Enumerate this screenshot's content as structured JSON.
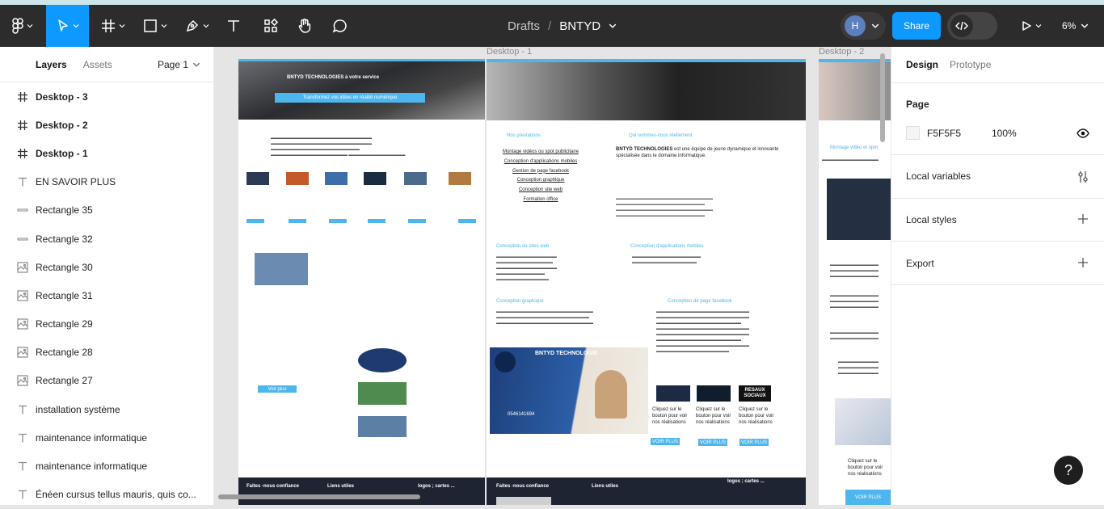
{
  "toolbar": {
    "breadcrumb_project": "Drafts",
    "breadcrumb_separator": "/",
    "file_name": "BNTYD",
    "avatar_initial": "H",
    "share_label": "Share",
    "zoom_label": "6%",
    "accent_color": "#0d99ff"
  },
  "left_panel": {
    "tab_layers": "Layers",
    "tab_assets": "Assets",
    "page_selector": "Page 1",
    "layers": [
      {
        "label": "Desktop - 3",
        "icon": "frame-icon",
        "type": "frame"
      },
      {
        "label": "Desktop - 2",
        "icon": "frame-icon",
        "type": "frame"
      },
      {
        "label": "Desktop - 1",
        "icon": "frame-icon",
        "type": "frame"
      },
      {
        "label": "EN SAVOIR PLUS",
        "icon": "text-icon",
        "type": "text"
      },
      {
        "label": "Rectangle 35",
        "icon": "line-icon",
        "type": "shape"
      },
      {
        "label": "Rectangle 32",
        "icon": "line-icon",
        "type": "shape"
      },
      {
        "label": "Rectangle 30",
        "icon": "image-icon",
        "type": "image"
      },
      {
        "label": "Rectangle 31",
        "icon": "image-icon",
        "type": "image"
      },
      {
        "label": "Rectangle 29",
        "icon": "image-icon",
        "type": "image"
      },
      {
        "label": "Rectangle 28",
        "icon": "image-icon",
        "type": "image"
      },
      {
        "label": "Rectangle 27",
        "icon": "image-icon",
        "type": "image"
      },
      {
        "label": "installation système",
        "icon": "text-icon",
        "type": "text"
      },
      {
        "label": "maintenance informatique",
        "icon": "text-icon",
        "type": "text"
      },
      {
        "label": "maintenance informatique",
        "icon": "text-icon",
        "type": "text"
      },
      {
        "label": "Énéen cursus tellus mauris, quis co...",
        "icon": "text-icon",
        "type": "text"
      }
    ]
  },
  "canvas": {
    "frame_labels": [
      "Desktop - 1",
      "Desktop - 2"
    ],
    "frame3": {
      "hero_title": "BNTYD TECHNOLOGIES à votre service",
      "hero_button": "Transformez vos idées en réalité numérique",
      "footer_a": "Faites -nous confiance",
      "footer_b": "Liens utiles",
      "footer_c": "logos ; cartes ...",
      "cta": "Voir plus"
    },
    "frame1": {
      "heading_left": "Nos prestations",
      "heading_right": "Qui sommes-nous réellement",
      "links": [
        "Montage vidéos ou spot publicitaire",
        "Conception d'applications mobiles",
        "Gestion de page facebook",
        "Conception graphique",
        "Conception site web",
        "Formation office"
      ],
      "intro_brand": "BNTYD TECHNOLOGIES",
      "intro_text": "est une équipe de jeune dynamique et innovante spécialisée dans le domaine informatique.",
      "section_web": "Conception de sites web",
      "section_apps": "Conception d'applications mobiles",
      "section_graphic": "Conception graphique",
      "section_fb": "Conception de page facebook",
      "flyer_title": "BNTYD TECHNOLOGIE",
      "flyer_phone": "0546141694",
      "cards_caption": "Cliquez sur le bouton pour voir nos réalisations",
      "card_badge": "RESAUX SOCIAUX",
      "cta": "VOIR PLUS",
      "footer_a": "Faites -nous confiance",
      "footer_b": "Liens utiles",
      "footer_c": "logos ; cartes ..."
    },
    "frame2": {
      "heading": "Montage vidéo et spot",
      "caption": "Cliquez sur le bouton pour voir nos réalisations",
      "cta": "VOIR PLUS"
    }
  },
  "right_panel": {
    "tab_design": "Design",
    "tab_prototype": "Prototype",
    "page_heading": "Page",
    "page_color": "F5F5F5",
    "page_opacity": "100%",
    "local_variables": "Local variables",
    "local_styles": "Local styles",
    "export": "Export"
  },
  "help_label": "?"
}
